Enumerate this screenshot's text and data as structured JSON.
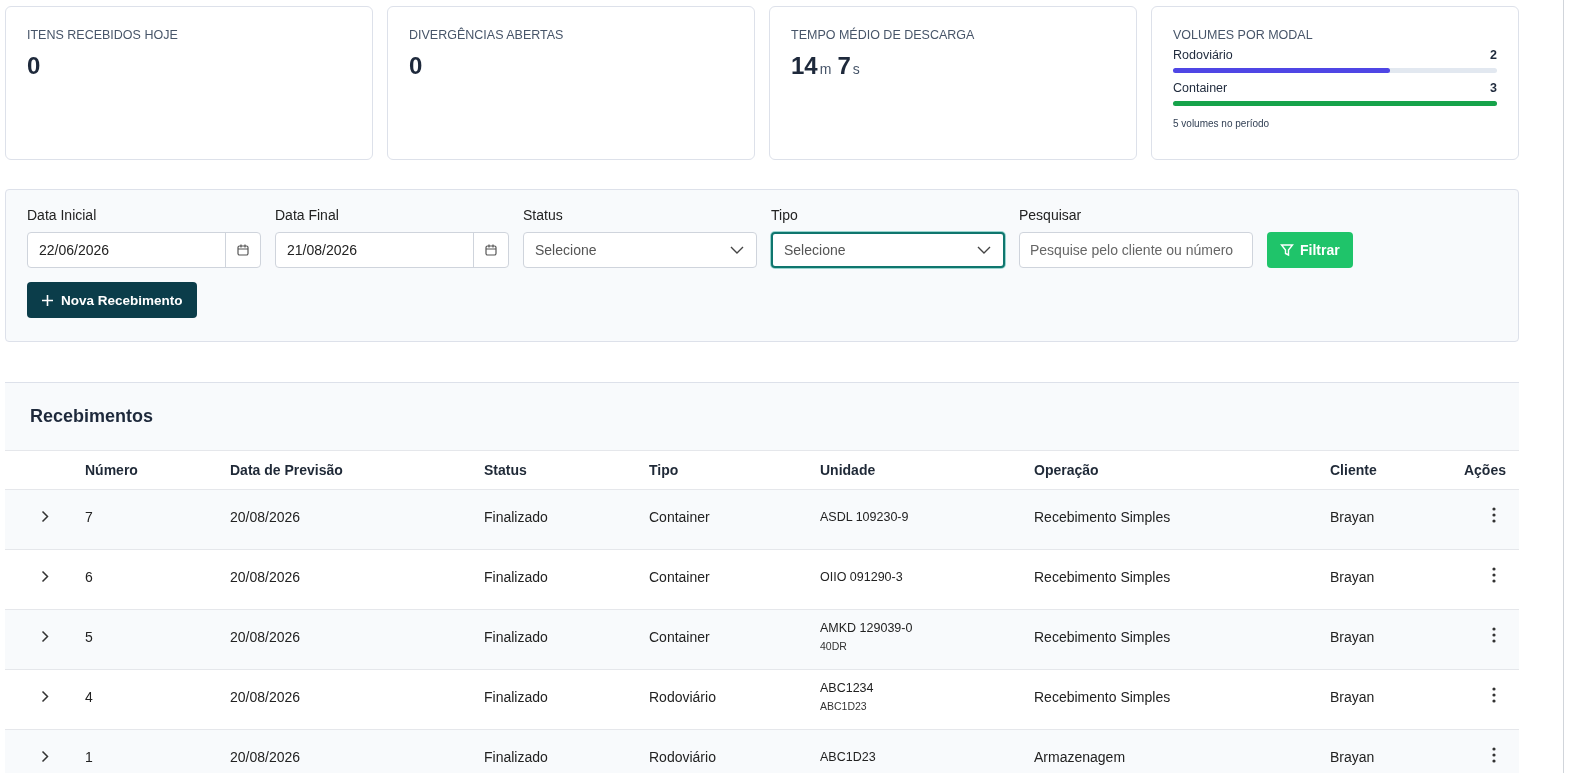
{
  "stats": [
    {
      "kind": "count",
      "label": "ITENS RECEBIDOS HOJE",
      "value": "0"
    },
    {
      "kind": "count",
      "label": "DIVERGÊNCIAS ABERTAS",
      "value": "0"
    },
    {
      "kind": "duration",
      "label": "TEMPO MÉDIO DE DESCARGA",
      "parts": [
        {
          "value": "14",
          "unit": "m"
        },
        {
          "value": "7",
          "unit": "s"
        }
      ]
    },
    {
      "kind": "modal",
      "label": "VOLUMES POR MODAL",
      "bars": [
        {
          "name": "Rodoviário",
          "count": "2",
          "level": 0.67,
          "color": "#4f46e5"
        },
        {
          "name": "Container",
          "count": "3",
          "level": 1,
          "color": "#16a34a"
        }
      ],
      "footnote": "5 volumes no período"
    }
  ],
  "filters": [
    {
      "kind": "date",
      "label": "Data Inicial",
      "value": "22/06/2026",
      "focused": false
    },
    {
      "kind": "date",
      "label": "Data Final",
      "value": "21/08/2026",
      "focused": false
    },
    {
      "kind": "select",
      "label": "Status",
      "placeholder": "Selecione",
      "focused": false
    },
    {
      "kind": "select",
      "label": "Tipo",
      "placeholder": "Selecione",
      "focused": true
    },
    {
      "kind": "search",
      "label": "Pesquisar",
      "placeholder": "Pesquise pelo cliente ou número",
      "focused": false
    }
  ],
  "filter_button": "Filtrar",
  "new_button": "Nova Recebimento",
  "table": {
    "title": "Recebimentos",
    "columns": [
      "Número",
      "Data de Previsão",
      "Status",
      "Tipo",
      "Unidade",
      "Operação",
      "Cliente",
      "Ações"
    ],
    "rows": [
      {
        "numero": "7",
        "data": "20/08/2026",
        "status": "Finalizado",
        "tipo": "Container",
        "unidade": "ASDL 109230-9",
        "operacao": "Recebimento Simples",
        "cliente": "Brayan"
      },
      {
        "numero": "6",
        "data": "20/08/2026",
        "status": "Finalizado",
        "tipo": "Container",
        "unidade": "OIIO 091290-3",
        "operacao": "Recebimento Simples",
        "cliente": "Brayan"
      },
      {
        "numero": "5",
        "data": "20/08/2026",
        "status": "Finalizado",
        "tipo": "Container",
        "unidade": "AMKD 129039-0",
        "unidade_sub": "40DR",
        "operacao": "Recebimento Simples",
        "cliente": "Brayan"
      },
      {
        "numero": "4",
        "data": "20/08/2026",
        "status": "Finalizado",
        "tipo": "Rodoviário",
        "unidade": "ABC1234",
        "unidade_sub": "ABC1D23",
        "operacao": "Recebimento Simples",
        "cliente": "Brayan"
      },
      {
        "numero": "1",
        "data": "20/08/2026",
        "status": "Finalizado",
        "tipo": "Rodoviário",
        "unidade": "ABC1D23",
        "operacao": "Armazenagem",
        "cliente": "Brayan"
      }
    ]
  }
}
